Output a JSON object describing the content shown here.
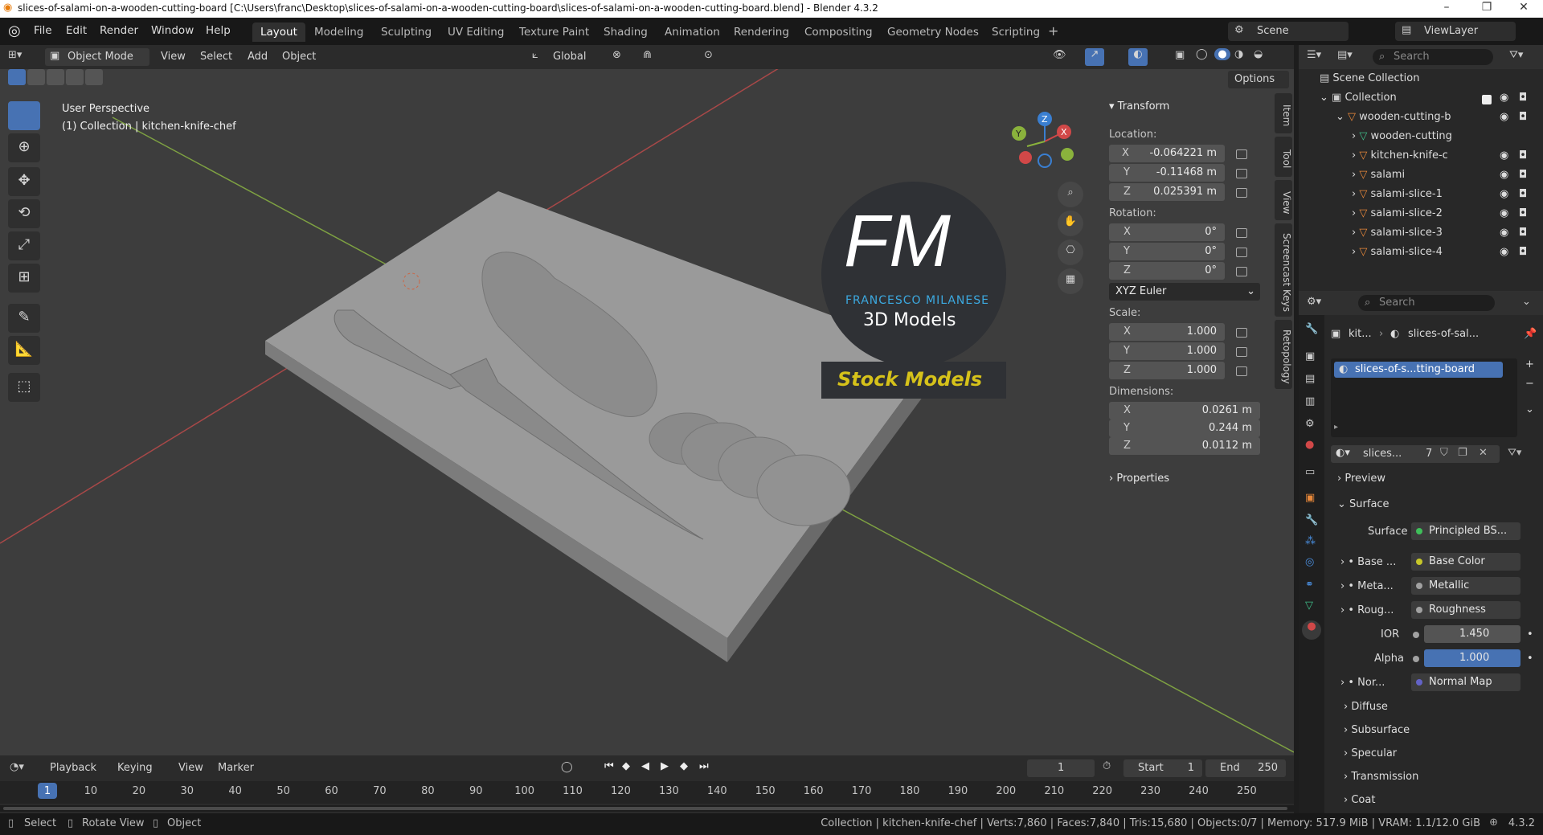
{
  "titlebar": {
    "title": "slices-of-salami-on-a-wooden-cutting-board [C:\\Users\\franc\\Desktop\\slices-of-salami-on-a-wooden-cutting-board\\slices-of-salami-on-a-wooden-cutting-board.blend] - Blender 4.3.2"
  },
  "menu": [
    "File",
    "Edit",
    "Render",
    "Window",
    "Help"
  ],
  "workspaces": [
    "Layout",
    "Modeling",
    "Sculpting",
    "UV Editing",
    "Texture Paint",
    "Shading",
    "Animation",
    "Rendering",
    "Compositing",
    "Geometry Nodes",
    "Scripting"
  ],
  "scene": {
    "label": "Scene",
    "viewlayer": "ViewLayer"
  },
  "header": {
    "mode": "Object Mode",
    "menus": [
      "View",
      "Select",
      "Add",
      "Object"
    ],
    "orientation": "Global",
    "options": "Options"
  },
  "viewport": {
    "perspective": "User Perspective",
    "collection": "(1) Collection | kitchen-knife-chef"
  },
  "watermark": {
    "logo": "FM",
    "company": "FRANCESCO MILANESE",
    "tagline": "3D Models",
    "badge": "Stock Models"
  },
  "transform": {
    "title": "Transform",
    "location_label": "Location:",
    "location": [
      {
        "axis": "X",
        "value": "-0.064221 m"
      },
      {
        "axis": "Y",
        "value": "-0.11468 m"
      },
      {
        "axis": "Z",
        "value": "0.025391 m"
      }
    ],
    "rotation_label": "Rotation:",
    "rotation": [
      {
        "axis": "X",
        "value": "0°"
      },
      {
        "axis": "Y",
        "value": "0°"
      },
      {
        "axis": "Z",
        "value": "0°"
      }
    ],
    "rotation_mode": "XYZ Euler",
    "scale_label": "Scale:",
    "scale": [
      {
        "axis": "X",
        "value": "1.000"
      },
      {
        "axis": "Y",
        "value": "1.000"
      },
      {
        "axis": "Z",
        "value": "1.000"
      }
    ],
    "dimensions_label": "Dimensions:",
    "dimensions": [
      {
        "axis": "X",
        "value": "0.0261 m"
      },
      {
        "axis": "Y",
        "value": "0.244 m"
      },
      {
        "axis": "Z",
        "value": "0.0112 m"
      }
    ],
    "properties": "Properties"
  },
  "sidetabs": [
    "Item",
    "Tool",
    "View",
    "Screencast Keys",
    "Retopology"
  ],
  "outliner": {
    "search": "Search",
    "items": [
      {
        "label": "Scene Collection",
        "indent": 0
      },
      {
        "label": "Collection",
        "indent": 1
      },
      {
        "label": "wooden-cutting-b",
        "indent": 2
      },
      {
        "label": "wooden-cutting",
        "indent": 3
      },
      {
        "label": "kitchen-knife-c",
        "indent": 3
      },
      {
        "label": "salami",
        "indent": 3
      },
      {
        "label": "salami-slice-1",
        "indent": 3
      },
      {
        "label": "salami-slice-2",
        "indent": 3
      },
      {
        "label": "salami-slice-3",
        "indent": 3
      },
      {
        "label": "salami-slice-4",
        "indent": 3
      }
    ]
  },
  "properties": {
    "search": "Search",
    "breadcrumb1": "kit...",
    "breadcrumb2": "slices-of-sal...",
    "material_slot": "slices-of-s...tting-board",
    "material_name": "slices...",
    "users": "7",
    "preview": "Preview",
    "surface_section": "Surface",
    "surface_label": "Surface",
    "surface_value": "Principled BS...",
    "rows": [
      {
        "label": "Base ...",
        "value": "Base Color",
        "color": "#c7c729"
      },
      {
        "label": "Meta...",
        "value": "Metallic",
        "color": "#a1a1a1"
      },
      {
        "label": "Roug...",
        "value": "Roughness",
        "color": "#a1a1a1"
      },
      {
        "label": "IOR",
        "value": "1.450",
        "color": "#a1a1a1"
      },
      {
        "label": "Alpha",
        "value": "1.000",
        "color": "#a1a1a1"
      },
      {
        "label": "Nor...",
        "value": "Normal Map",
        "color": "#6363c7"
      }
    ],
    "sections": [
      "Diffuse",
      "Subsurface",
      "Specular",
      "Transmission",
      "Coat"
    ]
  },
  "timeline": {
    "menus": [
      "Playback",
      "Keying",
      "View",
      "Marker"
    ],
    "current": "1",
    "start_label": "Start",
    "start": "1",
    "end_label": "End",
    "end": "250",
    "frames": [
      "1",
      "10",
      "20",
      "30",
      "40",
      "50",
      "60",
      "70",
      "80",
      "90",
      "100",
      "110",
      "120",
      "130",
      "140",
      "150",
      "160",
      "170",
      "180",
      "190",
      "200",
      "210",
      "220",
      "230",
      "240",
      "250"
    ]
  },
  "status": {
    "left": [
      "Select",
      "Rotate View",
      "Object"
    ],
    "right": "Collection | kitchen-knife-chef | Verts:7,860 | Faces:7,840 | Tris:15,680 | Objects:0/7 | Memory: 517.9 MiB | VRAM: 1.1/12.0 GiB",
    "version": "4.3.2"
  }
}
